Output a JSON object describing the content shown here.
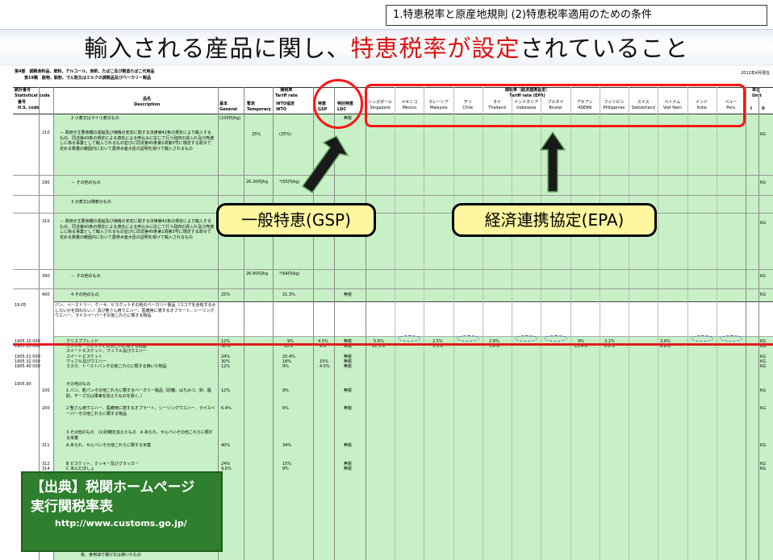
{
  "header_box": "1.特恵税率と原産地規則 (2)特恵税率適用のための条件",
  "title": {
    "pre": "輸入される産品に関し、",
    "highlight": "特恵税率が設定",
    "post": "されていること"
  },
  "sheet": {
    "chapter": "第4部　調製食料品、飲料、アルコール、食酢、たばこ及び製造たばこ代用品",
    "section": "第19類　穀物、穀粉、でん粉又はミルクの調製品及びベーカリー製品",
    "date": "2012年4月現在",
    "col_stat": "統計番号\nStatistical code",
    "col_num": "番号\nH.S. code",
    "col_item": "品名\nDescription",
    "col_tariff": "関税率\nTariff rate",
    "col_general": "基本\nGeneral",
    "col_temp": "暫定\nTemporary",
    "col_wto": "WTO協定\nWTO",
    "col_gsp": "特恵\nGSP",
    "col_ldc": "特別特恵\nLDC",
    "col_epa": "関税率（経済連携協定）\nTariff rate (EPA)",
    "col_unit": "単位\nUnit",
    "countries": [
      {
        "ja": "シンガポール",
        "en": "Singapore"
      },
      {
        "ja": "メキシコ",
        "en": "Mexico"
      },
      {
        "ja": "マレーシア",
        "en": "Malaysia"
      },
      {
        "ja": "チリ",
        "en": "Chile"
      },
      {
        "ja": "タイ",
        "en": "Thailand"
      },
      {
        "ja": "インドネシア",
        "en": "Indonesia"
      },
      {
        "ja": "ブルネイ",
        "en": "Brunei"
      },
      {
        "ja": "アセアン",
        "en": "ASEAN"
      },
      {
        "ja": "フィリピン",
        "en": "Philippines"
      },
      {
        "ja": "スイス",
        "en": "Switzerland"
      },
      {
        "ja": "ベトナム",
        "en": "Viet Nam"
      },
      {
        "ja": "インド",
        "en": "India"
      },
      {
        "ja": "ペルー",
        "en": "Peru"
      }
    ],
    "unit_i": "I",
    "unit_ii": "II"
  },
  "rows": [
    {
      "num": "",
      "desc": "2 小麦又はライ小麦のもの",
      "gen": "(100円/kg)",
      "temp": "",
      "wto": "",
      "gsp": "",
      "ldc": "無税",
      "unit": ""
    },
    {
      "num": "210",
      "desc": "－ 政府が主要食糧の需給及び価格の安定に関する法律第42条の規定により輸入するもの、同法第43条の規定による適名による申込みに応じて行う政府の買入れ及び売渡しに係る事業として輸入されるもの並びに同法第45条第1項第3号に規定する政令で定める数量の範囲内において農林水産大臣の証明を受けて輸入されるもの",
      "gen": "",
      "temp": "25%",
      "wto": "(25%)",
      "gsp": "",
      "ldc": "",
      "unit": "KG"
    },
    {
      "num": "290",
      "desc": "－ その他のもの",
      "gen": "",
      "temp": "26.20円/kg",
      "wto": "*(55円/kg)",
      "gsp": "",
      "ldc": "",
      "unit": "KG"
    },
    {
      "num": "",
      "desc": "3 大麦又は裸麦のもの",
      "gen": "",
      "temp": "",
      "wto": "",
      "gsp": "",
      "ldc": "",
      "unit": ""
    },
    {
      "num": "310",
      "desc": "－ 政府が主要食糧の需給及び価格の安定に関する法律第42条の規定により輸入するもの、同法第43条の規定による適名による申込みに応じて行う政府の買入れ及び売渡しに係る事業として輸入されるもの並びに同法第45条第1項第3号に規定する政令で定める数量の範囲内において農林水産大臣の証明を受けて輸入されるもの",
      "gen": "",
      "temp": "",
      "wto": "",
      "gsp": "",
      "ldc": "",
      "unit": "KG"
    },
    {
      "num": "390",
      "desc": "－ その他のもの",
      "gen": "",
      "temp": "26.60円/kg",
      "wto": "*(64円/kg)",
      "gsp": "",
      "ldc": "",
      "unit": "KG"
    },
    {
      "num": "400",
      "desc": "4 その他のもの",
      "gen": "25%",
      "temp": "",
      "wto": "21.3%",
      "gsp": "",
      "ldc": "無税",
      "unit": "KG"
    }
  ],
  "heading_1905": {
    "code": "19.05",
    "desc": "パン、ペーストリー、ケーキ、ビスケットその他のベーカリー製品（ココアを含有するかしないかを問わない。）及び聖さん用ウエハー、医療用に適するオブラート、シーリングウエハー、ライスペーパーその他これらに類する物品"
  },
  "row_1905_10": {
    "code": "1905.10 000",
    "desc": "クリスプブレッド",
    "gen": "12%",
    "wto": "9%",
    "gsp": "4.5%",
    "ldc": "無税",
    "sg": "5.6%",
    "my": "2.5%",
    "th": "2.8%",
    "asean": "9%",
    "ph": "3.1%",
    "vn": "3.4%",
    "unit": "KG"
  },
  "row_1905_20": {
    "code": "1905.20 000",
    "desc": "ジンジャーブレッドその他これに類する物品",
    "gen": "30%",
    "wto": "18%",
    "gsp": "9%",
    "ldc": "無税",
    "sg": "11.3%",
    "my": "5.1%",
    "th": "5.6%",
    "asean": "13.9%",
    "ph": "6.2%",
    "vn": "6.8%",
    "unit": "KG"
  },
  "lower_rows": [
    {
      "code": "",
      "desc": "スイートビスケット、ワッフル及びウエハー",
      "gen": "",
      "wto": "",
      "gsp": "",
      "ldc": "",
      "unit": ""
    },
    {
      "code": "1905.31 000",
      "desc": "スイートビスケット",
      "gen": "24%",
      "wto": "20.4%",
      "gsp": "",
      "ldc": "無税",
      "unit": "KG"
    },
    {
      "code": "1905.32 000",
      "desc": "ワッフル及びウエハー",
      "gen": "30%",
      "wto": "18%",
      "gsp": "15%",
      "ldc": "無税",
      "unit": "KG"
    },
    {
      "code": "1905.40 000",
      "desc": "ラスク、トーストパンその他これらに類する焼いた物品",
      "gen": "12%",
      "wto": "9%",
      "gsp": "4.5%",
      "ldc": "無税",
      "unit": "KG"
    },
    {
      "code": "1905.90",
      "desc": "その他のもの",
      "gen": "",
      "wto": "",
      "gsp": "",
      "ldc": "",
      "unit": ""
    },
    {
      "code": "100",
      "desc": "1 パン、乾パンその他これらに類するベーカリー製品（砂糖、はちみつ、卵、脂肪、チーズ又は果実を加えたものを除く。）",
      "gen": "12%",
      "wto": "9%",
      "gsp": "",
      "ldc": "無税",
      "unit": "KG"
    },
    {
      "code": "200",
      "desc": "2 聖さん用ウエハー、医療用に適するオブラート、シーリングウエハー、ライスペーパーその他これらに類する物品",
      "gen": "6.4%",
      "wto": "6%",
      "gsp": "",
      "ldc": "無税",
      "unit": "KG"
    },
    {
      "code": "",
      "desc": "3 その他のもの　(1)砂糖を加えたもの　A あられ、せんべいその他これらに類する米菓",
      "gen": "",
      "wto": "",
      "gsp": "",
      "ldc": "",
      "unit": ""
    },
    {
      "code": "311",
      "desc": "A あられ、せんべいその他これらに類する米菓",
      "gen": "40%",
      "wto": "34%",
      "gsp": "",
      "ldc": "無税",
      "unit": "KG"
    },
    {
      "code": "312",
      "desc": "B ビスケット、クッキー及びクラッカー",
      "gen": "24%",
      "wto": "15%",
      "gsp": "",
      "ldc": "無税",
      "unit": "KG"
    },
    {
      "code": "314",
      "desc": "C あんだぽしょ",
      "gen": "9.6%",
      "wto": "9%",
      "gsp": "",
      "ldc": "無税",
      "unit": "KG"
    }
  ],
  "callout_gsp": "一般特恵(GSP)",
  "callout_epa": "経済連携協定(EPA)",
  "source": {
    "line1": "【出典】税関ホームページ",
    "line2": "実行関税率表",
    "url": "http://www.customs.go.jp/"
  },
  "last_desc": "後、食用油で揚げ又は焼いたもの"
}
